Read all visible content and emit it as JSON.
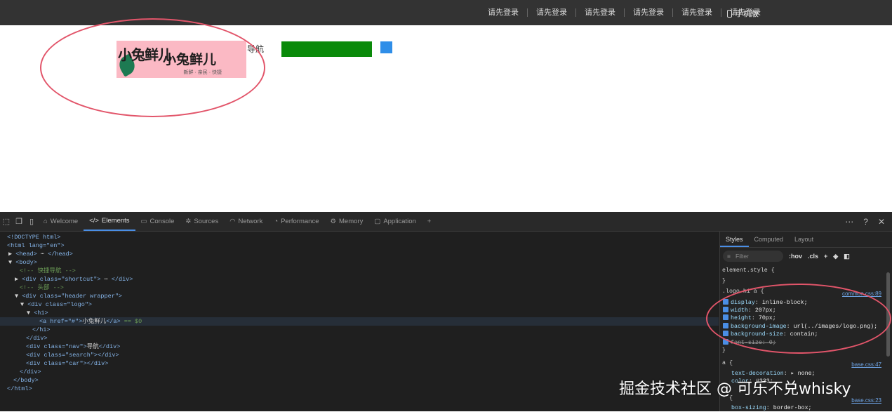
{
  "topbar": {
    "links": [
      "请先登录",
      "请先登录",
      "请先登录",
      "请先登录",
      "请先登录",
      "请先登录"
    ],
    "mobile_label": "手机版"
  },
  "page": {
    "logo_text": "小兔鲜儿",
    "logo_tagline": "新鲜 · 亲民 · 快捷",
    "nav_text": "导航"
  },
  "devtools": {
    "tabs": [
      {
        "icon": "home-icon",
        "label": "Welcome"
      },
      {
        "icon": "code-icon",
        "label": "Elements"
      },
      {
        "icon": "console-icon",
        "label": "Console"
      },
      {
        "icon": "bug-icon",
        "label": "Sources"
      },
      {
        "icon": "wifi-icon",
        "label": "Network"
      },
      {
        "icon": "gauge-icon",
        "label": "Performance"
      },
      {
        "icon": "memory-icon",
        "label": "Memory"
      },
      {
        "icon": "window-icon",
        "label": "Application"
      }
    ],
    "active_tab": "Elements",
    "dom_lines": [
      "<!DOCTYPE html>",
      "<html lang=\"en\">",
      "<head>",
      "</head>",
      "<body>",
      "<!-- 快捷导航 -->",
      "<div class=\"shortcut\">",
      "</div>",
      "<!-- 头部 -->",
      "<div class=\"header wrapper\">",
      "<div class=\"logo\">",
      "<h1>",
      "<a href=\"#\">",
      "小兔鲜儿",
      "</a>",
      "== $0",
      "</h1>",
      "</div>",
      "<div class=\"nav\">",
      "导航",
      "</div>",
      "<div class=\"search\"></div>",
      "<div class=\"car\"></div>",
      "</div>",
      "</body>",
      "</html>"
    ],
    "styles": {
      "tabs": [
        "Styles",
        "Computed",
        "Layout"
      ],
      "filter_placeholder": "Filter",
      "hov": ":hov",
      "cls": ".cls",
      "element_style": "element.style {",
      "close_brace": "}",
      "rule1_selector": ".logo h1 a {",
      "rule1_source": "common.css:89",
      "rule1_props": [
        {
          "name": "display",
          "value": "inline-block;"
        },
        {
          "name": "width",
          "value": "207px;"
        },
        {
          "name": "height",
          "value": "70px;"
        },
        {
          "name": "background-image",
          "value": "url(../images/logo.png);"
        },
        {
          "name": "background-size",
          "value": "contain;"
        },
        {
          "name": "font-size",
          "value": "0;"
        }
      ],
      "rule2_selector": "a {",
      "rule2_source": "base.css:47",
      "rule2_props": [
        {
          "name": "text-decoration",
          "value": "▸ none;"
        },
        {
          "name": "color",
          "value": "#333;"
        }
      ],
      "rule3_selector": "* {",
      "rule3_source": "base.css:23",
      "rule3_props": [
        {
          "name": "box-sizing",
          "value": "border-box;"
        }
      ]
    }
  },
  "watermark": "掘金技术社区 @ 可乐不兑whisky",
  "colors": {
    "annotation": "#e2556a",
    "logo_bg": "#fbb9c4",
    "search": "#0a8a0a",
    "car": "#2f8ee8"
  }
}
